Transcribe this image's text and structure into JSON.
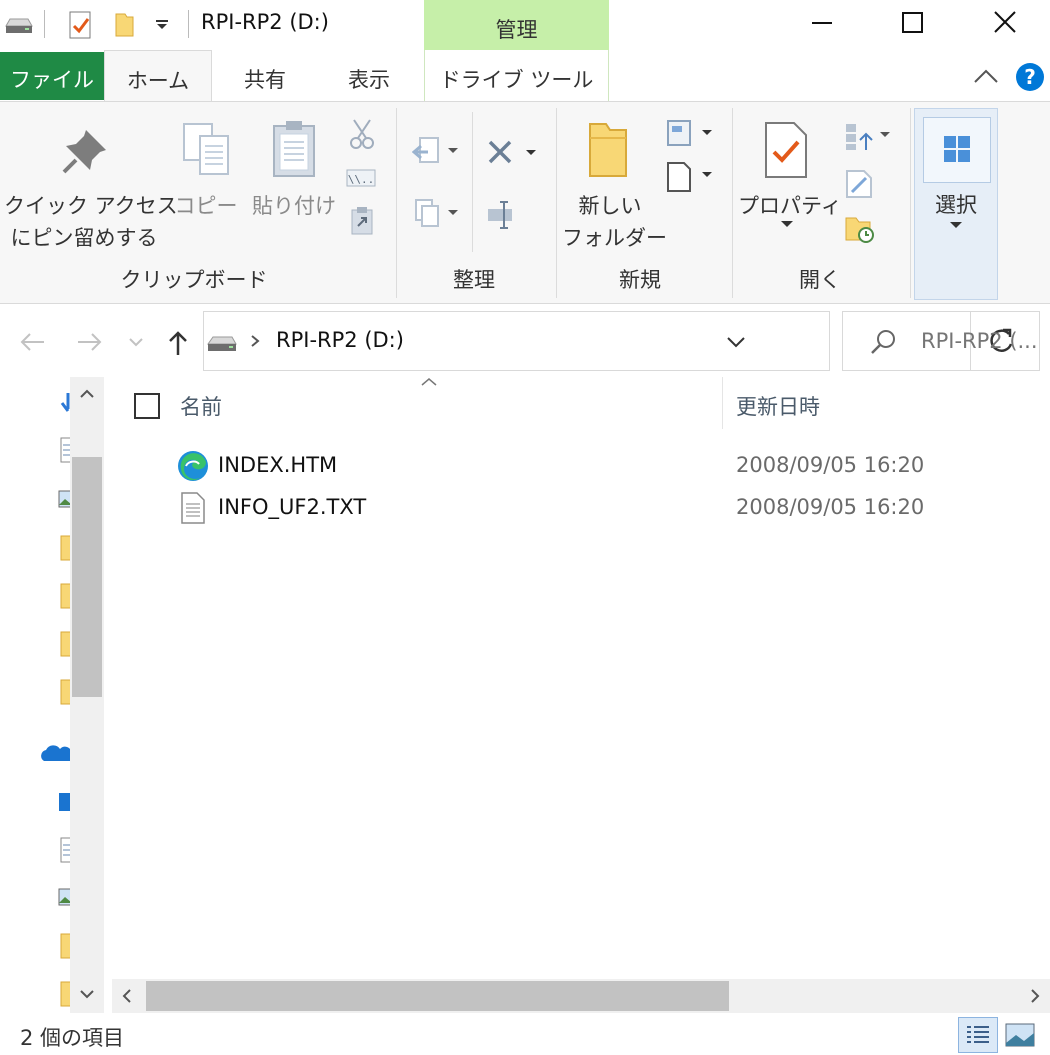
{
  "window": {
    "title": "RPI-RP2 (D:)",
    "context_tab_group": "管理"
  },
  "tabs": {
    "file": "ファイル",
    "home": "ホーム",
    "share": "共有",
    "view": "表示",
    "drive_tools": "ドライブ ツール"
  },
  "ribbon": {
    "pin_line1": "クイック アクセス",
    "pin_line2": "にピン留めする",
    "copy": "コピー",
    "paste": "貼り付け",
    "group_clipboard": "クリップボード",
    "group_organize": "整理",
    "new_folder_line1": "新しい",
    "new_folder_line2": "フォルダー",
    "group_new": "新規",
    "properties": "プロパティ",
    "group_open": "開く",
    "select": "選択"
  },
  "address": {
    "path": "RPI-RP2 (D:)",
    "search_placeholder": "RPI-RP2 (..."
  },
  "columns": {
    "name": "名前",
    "modified": "更新日時"
  },
  "files": [
    {
      "name": "INDEX.HTM",
      "modified": "2008/09/05 16:20",
      "icon": "edge-icon"
    },
    {
      "name": "INFO_UF2.TXT",
      "modified": "2008/09/05 16:20",
      "icon": "text-file-icon"
    }
  ],
  "status": {
    "item_count": "2 個の項目"
  },
  "colors": {
    "file_tab": "#1f8a45",
    "manage_tab": "#c6efa9",
    "accent_blue": "#0078d7",
    "folder_yellow": "#f8d775"
  }
}
